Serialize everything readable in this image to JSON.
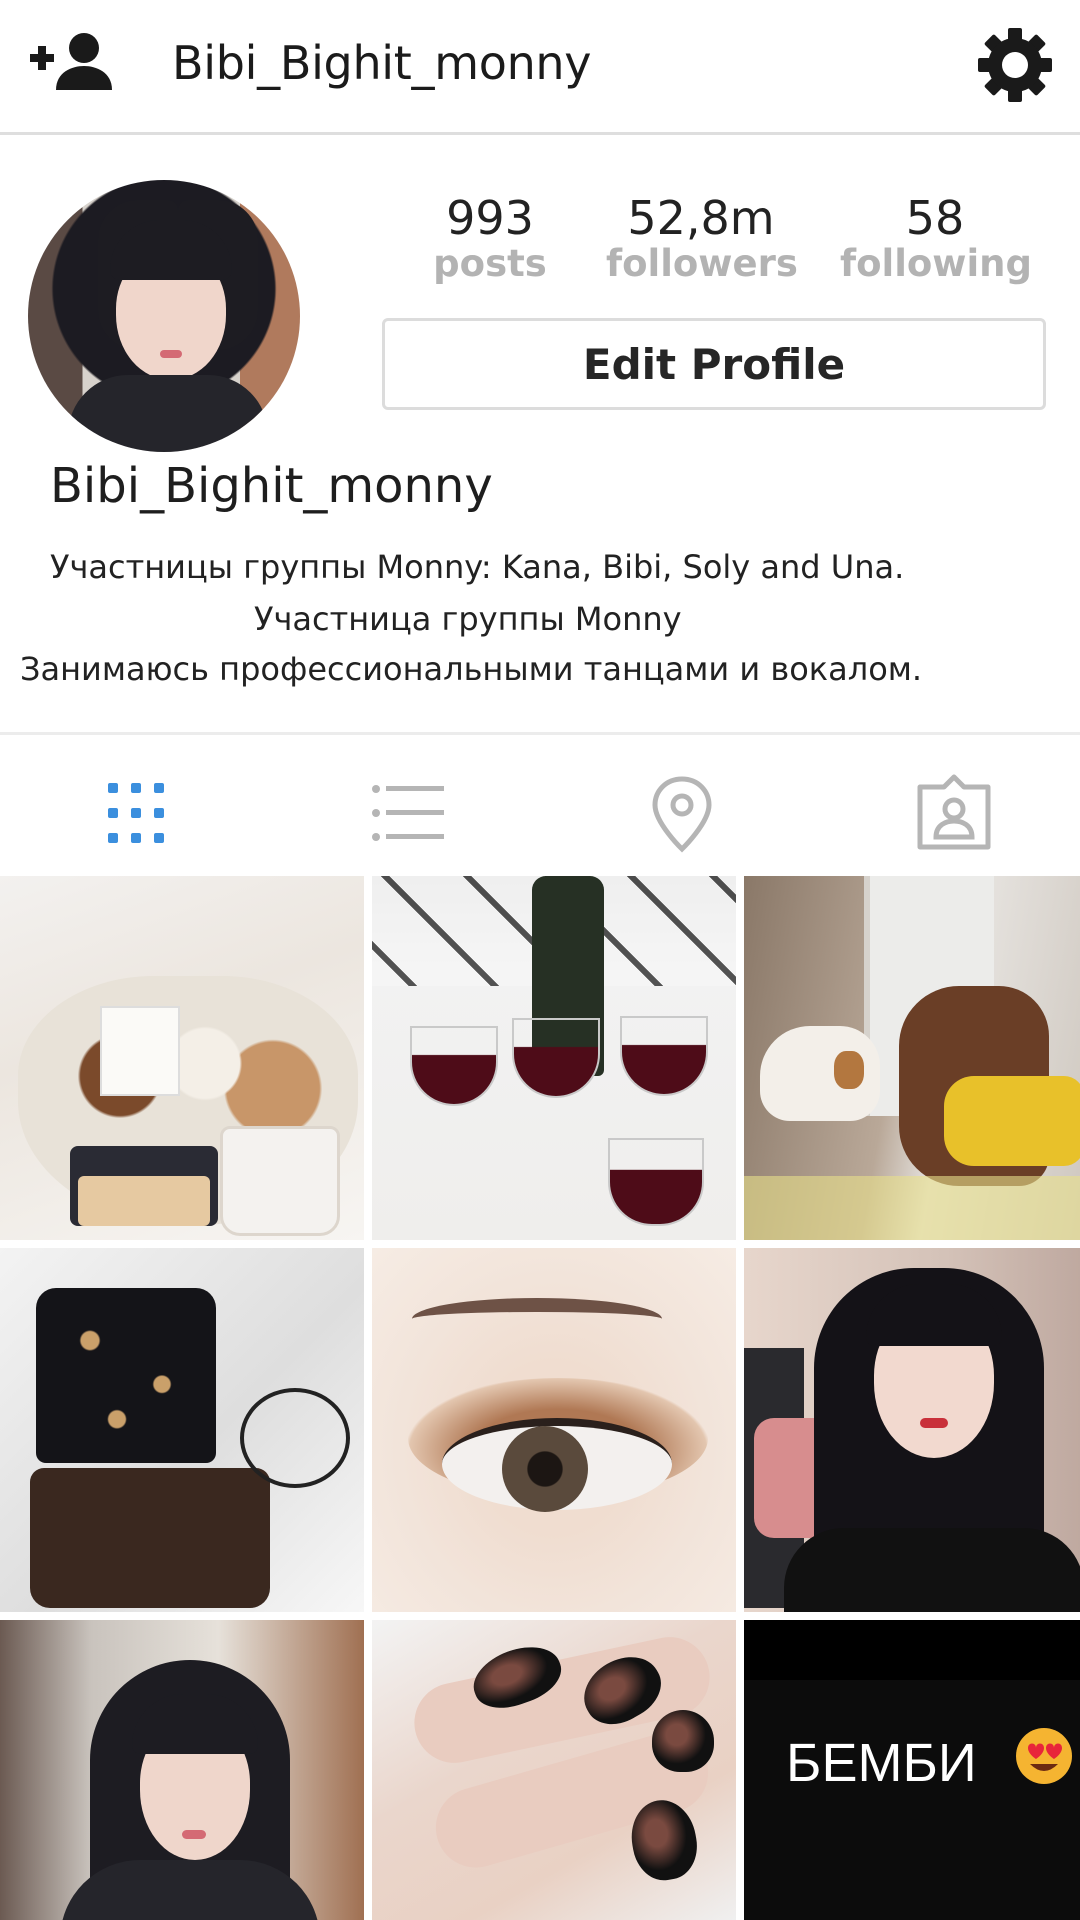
{
  "header": {
    "username": "Bibi_Bighit_monny",
    "add_user_icon": "add-user-icon",
    "settings_icon": "gear-icon"
  },
  "profile": {
    "display_name": "Bibi_Bighit_monny",
    "stats": {
      "posts": {
        "value": "993",
        "label": "posts"
      },
      "followers": {
        "value": "52,8m",
        "label": "followers"
      },
      "following": {
        "value": "58",
        "label": "following"
      }
    },
    "edit_button_label": "Edit Profile",
    "bio": [
      "Участницы группы Monny: Kana, Bibi, Soly and Una.",
      "Участница группы Monny",
      "Занимаюсь профессиональными танцами и вокалом."
    ]
  },
  "tabs": [
    {
      "name": "grid",
      "icon": "grid-icon",
      "active": true,
      "color": "#3b8fde"
    },
    {
      "name": "list",
      "icon": "list-icon",
      "active": false,
      "color": "#b5b5b5"
    },
    {
      "name": "location",
      "icon": "location-pin-icon",
      "active": false,
      "color": "#b5b5b5"
    },
    {
      "name": "tagged",
      "icon": "tagged-person-icon",
      "active": false,
      "color": "#b5b5b5"
    }
  ],
  "posts": {
    "bembi_text": "БЕМБИ",
    "bembi_emoji": "heart-eyes-emoji"
  },
  "colors": {
    "accent": "#3b8fde",
    "inactive_icon": "#b5b5b5",
    "stat_label": "#b3b3b3",
    "divider": "#dedede"
  }
}
